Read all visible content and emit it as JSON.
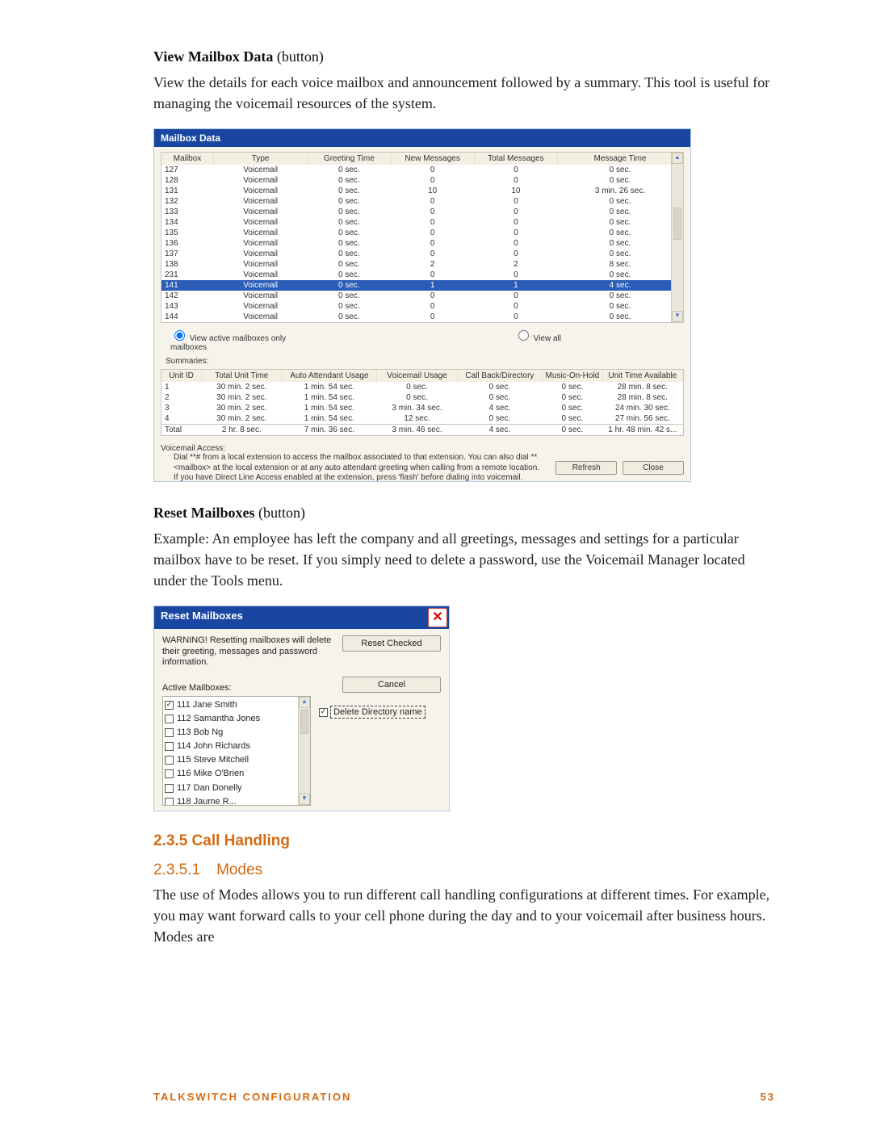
{
  "doc": {
    "view_mailbox_bold": "View Mailbox Data",
    "view_mailbox_paren": " (button)",
    "view_mailbox_desc": "View the details for each voice mailbox and announcement followed by a summary. This tool is useful for managing the voicemail resources of the system.",
    "reset_bold": "Reset Mailboxes",
    "reset_paren": " (button)",
    "reset_desc": "Example: An employee has left the company and all greetings, messages and settings for a particular mailbox have to be reset. If you simply need to delete a password, use the Voicemail Manager located under the Tools menu.",
    "sec235": "2.3.5  Call Handling",
    "sec2351_num": "2.3.5.1",
    "sec2351_title": "Modes",
    "modes_desc": "The use of Modes allows you to run different call handling configurations at different times. For example, you may want forward calls to your cell phone during the day and to your voicemail after business hours. Modes are",
    "footer_left": "TALKSWITCH CONFIGURATION",
    "footer_right": "53"
  },
  "mailbox_panel": {
    "title": "Mailbox Data",
    "headers": {
      "mailbox": "Mailbox",
      "type": "Type",
      "greeting": "Greeting Time",
      "new_msgs": "New Messages",
      "total_msgs": "Total Messages",
      "msg_time": "Message Time"
    },
    "rows": [
      {
        "mb": "127",
        "type": "Voicemail",
        "gt": "0 sec.",
        "nm": "0",
        "tm": "0",
        "mt": "0 sec."
      },
      {
        "mb": "128",
        "type": "Voicemail",
        "gt": "0 sec.",
        "nm": "0",
        "tm": "0",
        "mt": "0 sec."
      },
      {
        "mb": "131",
        "type": "Voicemail",
        "gt": "0 sec.",
        "nm": "10",
        "tm": "10",
        "mt": "3 min. 26 sec."
      },
      {
        "mb": "132",
        "type": "Voicemail",
        "gt": "0 sec.",
        "nm": "0",
        "tm": "0",
        "mt": "0 sec."
      },
      {
        "mb": "133",
        "type": "Voicemail",
        "gt": "0 sec.",
        "nm": "0",
        "tm": "0",
        "mt": "0 sec."
      },
      {
        "mb": "134",
        "type": "Voicemail",
        "gt": "0 sec.",
        "nm": "0",
        "tm": "0",
        "mt": "0 sec."
      },
      {
        "mb": "135",
        "type": "Voicemail",
        "gt": "0 sec.",
        "nm": "0",
        "tm": "0",
        "mt": "0 sec."
      },
      {
        "mb": "136",
        "type": "Voicemail",
        "gt": "0 sec.",
        "nm": "0",
        "tm": "0",
        "mt": "0 sec."
      },
      {
        "mb": "137",
        "type": "Voicemail",
        "gt": "0 sec.",
        "nm": "0",
        "tm": "0",
        "mt": "0 sec."
      },
      {
        "mb": "138",
        "type": "Voicemail",
        "gt": "0 sec.",
        "nm": "2",
        "tm": "2",
        "mt": "8 sec."
      },
      {
        "mb": "231",
        "type": "Voicemail",
        "gt": "0 sec.",
        "nm": "0",
        "tm": "0",
        "mt": "0 sec."
      },
      {
        "mb": "141",
        "type": "Voicemail",
        "gt": "0 sec.",
        "nm": "1",
        "tm": "1",
        "mt": "4 sec.",
        "selected": true
      },
      {
        "mb": "142",
        "type": "Voicemail",
        "gt": "0 sec.",
        "nm": "0",
        "tm": "0",
        "mt": "0 sec."
      },
      {
        "mb": "143",
        "type": "Voicemail",
        "gt": "0 sec.",
        "nm": "0",
        "tm": "0",
        "mt": "0 sec."
      },
      {
        "mb": "144",
        "type": "Voicemail",
        "gt": "0 sec.",
        "nm": "0",
        "tm": "0",
        "mt": "0 sec."
      }
    ],
    "radio_active": "View active mailboxes only",
    "radio_all": "View all mailboxes",
    "summaries_label": "Summaries:",
    "sum_headers": {
      "unit": "Unit ID",
      "total_time": "Total Unit Time",
      "aa": "Auto Attendant Usage",
      "vm": "Voicemail Usage",
      "cb": "Call Back/Directory",
      "moh": "Music-On-Hold",
      "avail": "Unit Time Available"
    },
    "sum_rows": [
      {
        "u": "1",
        "tt": "30 min. 2 sec.",
        "aa": "1 min. 54 sec.",
        "vm": "0 sec.",
        "cb": "0 sec.",
        "moh": "0 sec.",
        "av": "28 min. 8 sec."
      },
      {
        "u": "2",
        "tt": "30 min. 2 sec.",
        "aa": "1 min. 54 sec.",
        "vm": "0 sec.",
        "cb": "0 sec.",
        "moh": "0 sec.",
        "av": "28 min. 8 sec."
      },
      {
        "u": "3",
        "tt": "30 min. 2 sec.",
        "aa": "1 min. 54 sec.",
        "vm": "3 min. 34 sec.",
        "cb": "4 sec.",
        "moh": "0 sec.",
        "av": "24 min. 30 sec."
      },
      {
        "u": "4",
        "tt": "30 min. 2 sec.",
        "aa": "1 min. 54 sec.",
        "vm": "12 sec.",
        "cb": "0 sec.",
        "moh": "0 sec.",
        "av": "27 min. 56 sec."
      }
    ],
    "sum_total": {
      "u": "Total",
      "tt": "2 hr. 8 sec.",
      "aa": "7 min. 36 sec.",
      "vm": "3 min. 46 sec.",
      "cb": "4 sec.",
      "moh": "0 sec.",
      "av": "1 hr. 48 min. 42 s..."
    },
    "vm_access_label": "Voicemail Access:",
    "vm_access_l1": "Dial **# from a local extension to access the mailbox associated to that extension. You can also dial **",
    "vm_access_l2": "<mailbox> at the local extension or at any auto attendant greeting when calling from a remote location.",
    "vm_access_l3": "If you have Direct Line Access enabled at the extension, press 'flash' before dialing into voicemail.",
    "refresh_btn": "Refresh",
    "close_btn": "Close"
  },
  "reset_panel": {
    "title": "Reset Mailboxes",
    "close_glyph": "✕",
    "warning": "WARNING! Resetting mailboxes will delete their greeting, messages and password information.",
    "reset_checked_btn": "Reset Checked",
    "active_label": "Active Mailboxes:",
    "cancel_btn": "Cancel",
    "delete_dir": "Delete Directory name",
    "list": [
      {
        "checked": true,
        "label": "111 Jane Smith"
      },
      {
        "checked": false,
        "label": "112 Samantha Jones"
      },
      {
        "checked": false,
        "label": "113 Bob Ng"
      },
      {
        "checked": false,
        "label": "114 John Richards"
      },
      {
        "checked": false,
        "label": "115 Steve Mitchell"
      },
      {
        "checked": false,
        "label": "116 Mike O'Brien"
      },
      {
        "checked": false,
        "label": "117 Dan Donelly"
      },
      {
        "checked": false,
        "label": "118 Jaume R..."
      }
    ]
  }
}
